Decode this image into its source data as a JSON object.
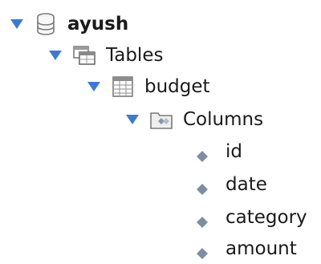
{
  "tree": {
    "schema": {
      "label": "ayush",
      "icon": "database-icon",
      "expanded": true
    },
    "tables_folder": {
      "label": "Tables",
      "icon": "tables-folder-icon",
      "expanded": true
    },
    "table": {
      "label": "budget",
      "icon": "table-icon",
      "expanded": true
    },
    "columns_folder": {
      "label": "Columns",
      "icon": "columns-folder-icon",
      "expanded": true
    },
    "columns": [
      {
        "label": "id",
        "icon": "column-diamond-icon"
      },
      {
        "label": "date",
        "icon": "column-diamond-icon"
      },
      {
        "label": "category",
        "icon": "column-diamond-icon"
      },
      {
        "label": "amount",
        "icon": "column-diamond-icon"
      }
    ]
  },
  "colors": {
    "arrow": "#3c7bd1",
    "diamond": "#7f8da3",
    "text": "#1a1a1a"
  }
}
